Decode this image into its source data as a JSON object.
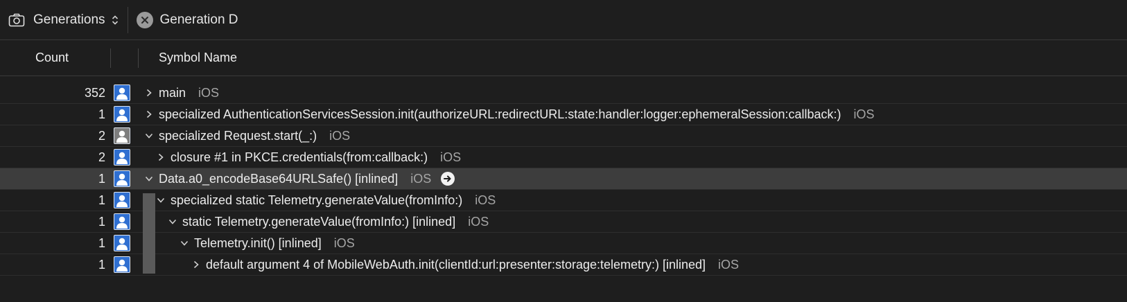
{
  "toolbar": {
    "icon": "camera-icon",
    "generations_label": "Generations",
    "generation_tab": "Generation D"
  },
  "columns": {
    "count": "Count",
    "symbol": "Symbol Name"
  },
  "rows": [
    {
      "count": "352",
      "symbol": "main",
      "platform": "iOS",
      "expanded": false,
      "depth": 0,
      "icon": "user-icon",
      "selected": false
    },
    {
      "count": "1",
      "symbol": "specialized AuthenticationServicesSession.init(authorizeURL:redirectURL:state:handler:logger:ephemeralSession:callback:)",
      "platform": "iOS",
      "expanded": false,
      "depth": 0,
      "icon": "user-icon",
      "selected": false
    },
    {
      "count": "2",
      "symbol": "specialized Request.start(_:)",
      "platform": "iOS",
      "expanded": true,
      "depth": 0,
      "icon": "user-gray-icon",
      "selected": false
    },
    {
      "count": "2",
      "symbol": "closure #1 in PKCE.credentials(from:callback:)",
      "platform": "iOS",
      "expanded": false,
      "depth": 1,
      "icon": "user-icon",
      "selected": false
    },
    {
      "count": "1",
      "symbol": "Data.a0_encodeBase64URLSafe() [inlined]",
      "platform": "iOS",
      "expanded": true,
      "depth": 0,
      "icon": "user-icon",
      "selected": true
    },
    {
      "count": "1",
      "symbol": "specialized static Telemetry.generateValue(fromInfo:)",
      "platform": "iOS",
      "expanded": true,
      "depth": 1,
      "icon": "user-icon",
      "selected": false
    },
    {
      "count": "1",
      "symbol": "static Telemetry.generateValue(fromInfo:) [inlined]",
      "platform": "iOS",
      "expanded": true,
      "depth": 2,
      "icon": "user-icon",
      "selected": false
    },
    {
      "count": "1",
      "symbol": "Telemetry.init() [inlined]",
      "platform": "iOS",
      "expanded": true,
      "depth": 3,
      "icon": "user-icon",
      "selected": false
    },
    {
      "count": "1",
      "symbol": "default argument 4 of MobileWebAuth.init(clientId:url:presenter:storage:telemetry:) [inlined]",
      "platform": "iOS",
      "expanded": false,
      "depth": 4,
      "icon": "user-icon",
      "selected": false
    }
  ]
}
